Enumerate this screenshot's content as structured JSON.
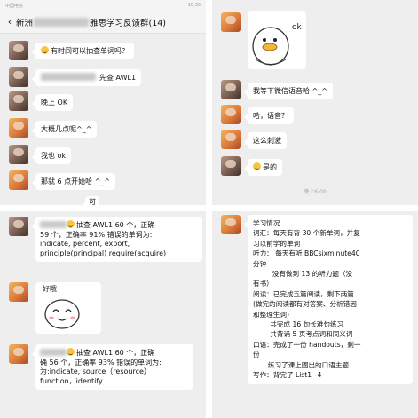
{
  "panel1": {
    "status_left": "中国电信",
    "status_time": "10:30",
    "header_prefix": "新洲",
    "header_suffix": "雅思学习反馈群(14)",
    "back_icon": "‹",
    "messages": [
      {
        "text": "有时间可以抽查单词吗？",
        "emoji": true
      },
      {
        "text": "先查 AWL1",
        "blurred_prefix": true
      },
      {
        "text": "晚上 OK"
      },
      {
        "text": "大概几点呢^_^"
      },
      {
        "text": "我也 ok"
      },
      {
        "text": "那就 6 点开始哈 ^_^"
      },
      {
        "text": "可"
      }
    ]
  },
  "panel2": {
    "sticker_text": "ok",
    "messages": [
      {
        "text": "我等下微信语音哈 ^_^"
      },
      {
        "text": "哈，语音？"
      },
      {
        "text": "这么刺激"
      },
      {
        "text": "是的",
        "emoji": true
      }
    ],
    "timestamp": "晚上6:00"
  },
  "panel3": {
    "messages": [
      {
        "lines": [
          "抽查 AWL1 60 个，正确",
          "59 个，正确率 91%  错误的单词为:",
          "indicate, percent, export,",
          "principle(principal) require(acquire)"
        ],
        "emoji": true
      },
      {
        "lines": [
          "抽查 AWL1 60 个，正确",
          "确 56 个，正确率 93%  错误的单词为:",
          "为:indicate, source（resource）",
          "function，identify"
        ],
        "emoji": true
      }
    ],
    "sticker_text": "好哦"
  },
  "panel4": {
    "lines": [
      "学习情况",
      "词汇：每天有背 30 个新单词，并复",
      "习以前学的单词",
      "听力：   每天有听 BBCsixminute40",
      "分钟",
      "         没有做到 13 的听力题（没",
      "有书）",
      "阅读：已完成五篇阅读，剩下两篇",
      "(做完的阅读都有对答案、分析错因",
      "和整理生词)",
      "        共完成 16 句长难句练习",
      "        共背诵 5 页考点词和同义词",
      "口语：完成了一份 handouts，剩一",
      "份",
      "       练习了课上圈出的口语主题",
      "写作：背完了 List1~4"
    ]
  }
}
